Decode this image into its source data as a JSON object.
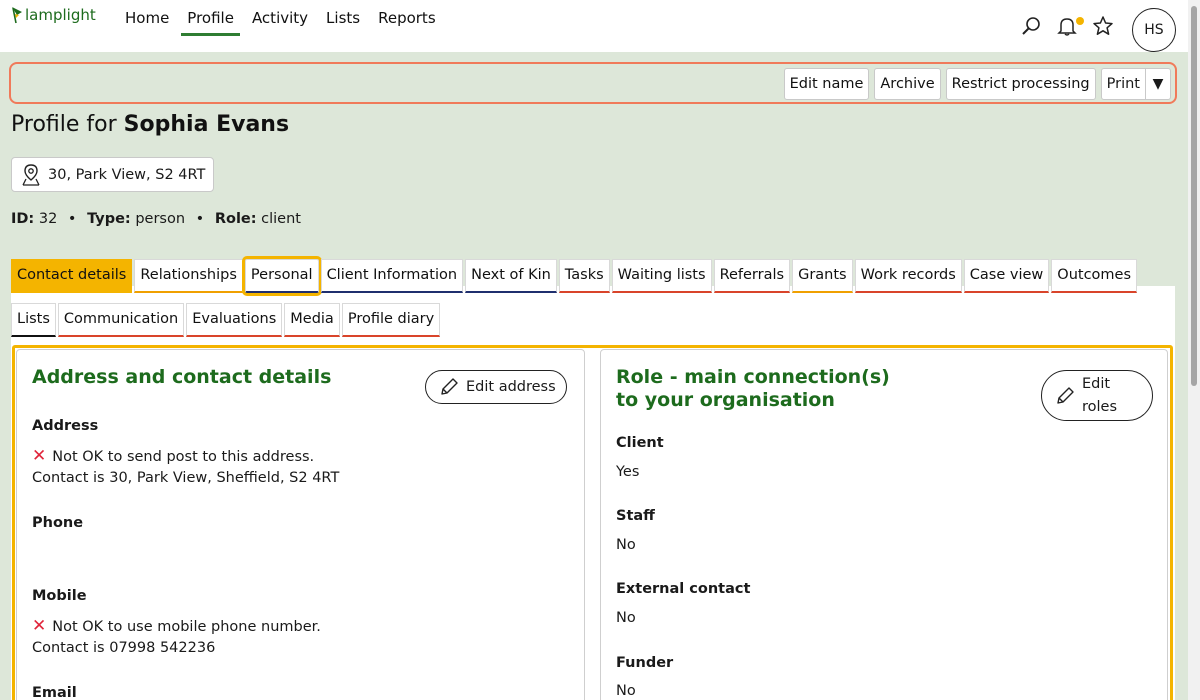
{
  "app": {
    "logo_text": "lamplight"
  },
  "nav": {
    "items": [
      {
        "label": "Home"
      },
      {
        "label": "Profile"
      },
      {
        "label": "Activity"
      },
      {
        "label": "Lists"
      },
      {
        "label": "Reports"
      }
    ],
    "active": "Profile"
  },
  "user": {
    "initials": "HS"
  },
  "actions": {
    "edit_name": "Edit name",
    "archive": "Archive",
    "restrict": "Restrict processing",
    "print": "Print",
    "print_caret": "▼"
  },
  "profile": {
    "title_prefix": "Profile for",
    "name": "Sophia Evans",
    "address_chip": "30, Park View, S2 4RT",
    "id_label": "ID:",
    "id_value": "32",
    "type_label": "Type:",
    "type_value": "person",
    "role_label": "Role:",
    "role_value": "client",
    "separator": "•"
  },
  "tabs_row1": [
    {
      "label": "Contact details"
    },
    {
      "label": "Relationships"
    },
    {
      "label": "Personal"
    },
    {
      "label": "Client Information"
    },
    {
      "label": "Next of Kin"
    },
    {
      "label": "Tasks"
    },
    {
      "label": "Waiting lists"
    },
    {
      "label": "Referrals"
    },
    {
      "label": "Grants"
    },
    {
      "label": "Work records"
    },
    {
      "label": "Case view"
    },
    {
      "label": "Outcomes"
    }
  ],
  "tabs_row2": [
    {
      "label": "Lists"
    },
    {
      "label": "Communication"
    },
    {
      "label": "Evaluations"
    },
    {
      "label": "Media"
    },
    {
      "label": "Profile diary"
    }
  ],
  "address_card": {
    "title": "Address and contact details",
    "edit_button": "Edit address",
    "address_label": "Address",
    "address_warning": "Not OK to send post to this address.",
    "address_value": "Contact is 30, Park View, Sheffield, S2 4RT",
    "phone_label": "Phone",
    "mobile_label": "Mobile",
    "mobile_warning": "Not OK to use mobile phone number.",
    "mobile_value": "Contact is 07998 542236",
    "email_label": "Email",
    "x_mark": "✕"
  },
  "role_card": {
    "title_line1": "Role - main connection(s)",
    "title_line2": "to your organisation",
    "edit_line1": "Edit",
    "edit_line2": "roles",
    "client_label": "Client",
    "client_value": "Yes",
    "staff_label": "Staff",
    "staff_value": "No",
    "external_label": "External contact",
    "external_value": "No",
    "funder_label": "Funder",
    "funder_value": "No"
  },
  "colors": {
    "brand_green": "#1d6b1d",
    "accent_yellow": "#f4b400",
    "action_bar_border": "#f07a5a",
    "page_bg": "#dde7d9",
    "warning_red": "#e0243a"
  }
}
